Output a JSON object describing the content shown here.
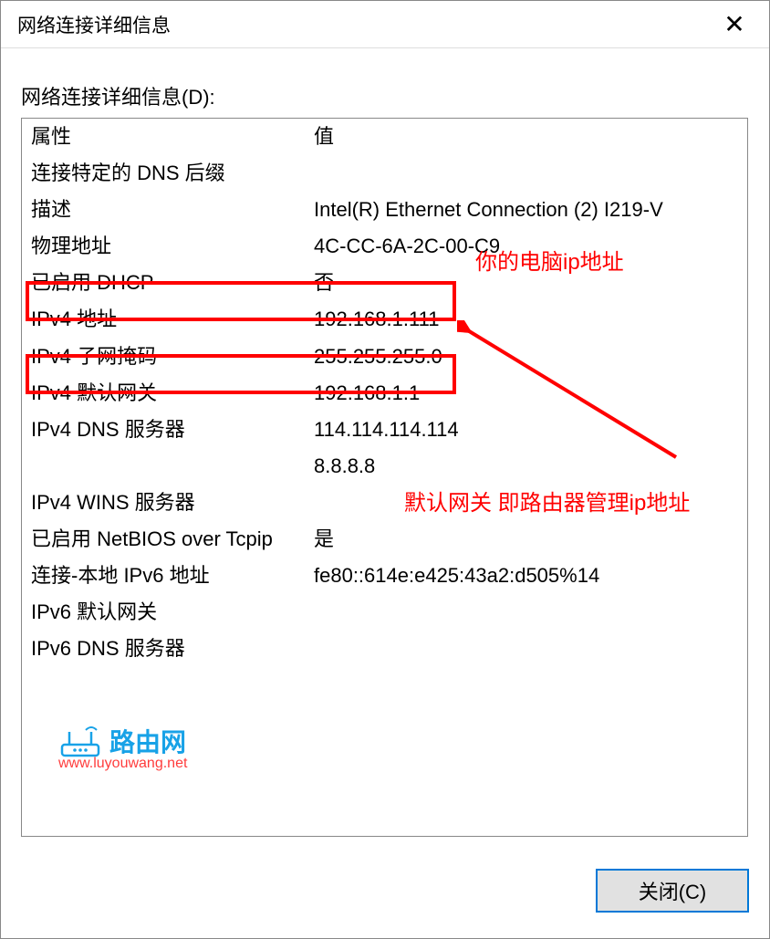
{
  "window": {
    "title": "网络连接详细信息"
  },
  "section_label": "网络连接详细信息(D):",
  "columns": {
    "property": "属性",
    "value": "值"
  },
  "rows": [
    {
      "prop": "连接特定的 DNS 后缀",
      "val": ""
    },
    {
      "prop": "描述",
      "val": "Intel(R) Ethernet Connection (2) I219-V"
    },
    {
      "prop": "物理地址",
      "val": "4C-CC-6A-2C-00-C9"
    },
    {
      "prop": "已启用 DHCP",
      "val": "否"
    },
    {
      "prop": "IPv4 地址",
      "val": "192.168.1.111"
    },
    {
      "prop": "IPv4 子网掩码",
      "val": "255.255.255.0"
    },
    {
      "prop": "IPv4 默认网关",
      "val": "192.168.1.1"
    },
    {
      "prop": "IPv4 DNS 服务器",
      "val": "114.114.114.114"
    },
    {
      "prop": "",
      "val": "8.8.8.8"
    },
    {
      "prop": "IPv4 WINS 服务器",
      "val": ""
    },
    {
      "prop": "已启用 NetBIOS over Tcpip",
      "val": "是"
    },
    {
      "prop": "连接-本地 IPv6 地址",
      "val": "fe80::614e:e425:43a2:d505%14"
    },
    {
      "prop": "IPv6 默认网关",
      "val": ""
    },
    {
      "prop": "IPv6 DNS 服务器",
      "val": ""
    }
  ],
  "annotations": {
    "ip_label": "你的电脑ip地址",
    "gateway_label": "默认网关 即路由器管理ip地址"
  },
  "button": {
    "close": "关闭(C)"
  },
  "watermark": {
    "name": "路由网",
    "url": "www.luyouwang.net"
  }
}
